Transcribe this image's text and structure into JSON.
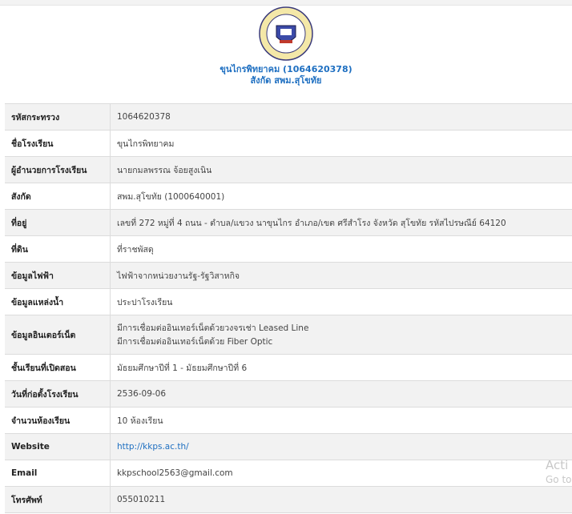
{
  "header": {
    "logo_alt": "school-logo",
    "title": "ขุนไกรพิทยาคม (1064620378)",
    "subtitle": "สังกัด สพม.สุโขทัย"
  },
  "rows": [
    {
      "label": "รหัสกระทรวง",
      "value": "1064620378"
    },
    {
      "label": "ชื่อโรงเรียน",
      "value": "ขุนไกรพิทยาคม"
    },
    {
      "label": "ผู้อำนวยการโรงเรียน",
      "value": "นายกมลพรรณ จ้อยสูงเนิน"
    },
    {
      "label": "สังกัด",
      "value": "สพม.สุโขทัย (1000640001)"
    },
    {
      "label": "ที่อยู่",
      "value": "เลขที่ 272 หมู่ที่ 4 ถนน - ตำบล/แขวง นาขุนไกร อำเภอ/เขต ศรีสำโรง จังหวัด สุโขทัย รหัสไปรษณีย์ 64120"
    },
    {
      "label": "ที่ดิน",
      "value": "ที่ราชพัสดุ"
    },
    {
      "label": "ข้อมูลไฟฟ้า",
      "value": "ไฟฟ้าจากหน่วยงานรัฐ-รัฐวิสาหกิจ"
    },
    {
      "label": "ข้อมูลแหล่งน้ำ",
      "value": "ประปาโรงเรียน"
    },
    {
      "label": "ข้อมูลอินเตอร์เน็ต",
      "value_lines": [
        "มีการเชื่อมต่ออินเทอร์เน็ตด้วยวงจรเช่า Leased Line",
        "มีการเชื่อมต่ออินเทอร์เน็ตด้วย Fiber Optic"
      ]
    },
    {
      "label": "ชั้นเรียนที่เปิดสอน",
      "value": "มัธยมศึกษาปีที่ 1 - มัธยมศึกษาปีที่ 6"
    },
    {
      "label": "วันที่ก่อตั้งโรงเรียน",
      "value": "2536-09-06"
    },
    {
      "label": "จำนวนห้องเรียน",
      "value": "10 ห้องเรียน"
    },
    {
      "label": "Website",
      "value": "http://kkps.ac.th/"
    },
    {
      "label": "Email",
      "value": "kkpschool2563@gmail.com"
    },
    {
      "label": "โทรศัพท์",
      "value": "055010211"
    }
  ],
  "watermark": {
    "line1": "Acti",
    "line2": "Go to"
  },
  "colors": {
    "link": "#1e6fc1",
    "row_alt": "#f2f2f2",
    "border": "#dcdcdc"
  }
}
